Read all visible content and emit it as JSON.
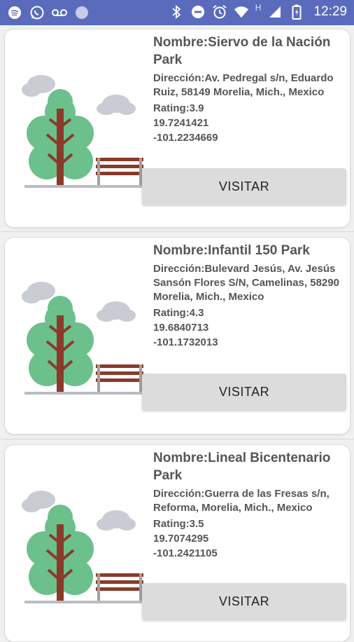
{
  "status_bar": {
    "time": "12:29",
    "network_label": "H",
    "left_icons": [
      "spotify-icon",
      "whatsapp-icon",
      "voicemail-icon",
      "circle-icon"
    ],
    "right_icons": [
      "bluetooth-icon",
      "do-not-disturb-icon",
      "alarm-icon",
      "wifi-icon",
      "signal-icon",
      "battery-icon"
    ]
  },
  "parks": [
    {
      "name": "Nombre:Siervo de la Nación Park",
      "address": "Dirección:Av. Pedregal s/n, Eduardo Ruiz, 58149 Morelia, Mich., Mexico",
      "rating": "Rating:3.9",
      "lat": "19.7241421",
      "lng": "-101.2234669",
      "button": "VISITAR"
    },
    {
      "name": "Nombre:Infantil 150 Park",
      "address": "Dirección:Bulevard Jesús, Av. Jesús Sansón Flores S/N, Camelinas, 58290 Morelia, Mich., Mexico",
      "rating": "Rating:4.3",
      "lat": "19.6840713",
      "lng": "-101.1732013",
      "button": "VISITAR"
    },
    {
      "name": "Nombre:Lineal Bicentenario Park",
      "address": "Dirección:Guerra de las Fresas s/n, Reforma, Morelia, Mich., Mexico",
      "rating": "Rating:3.5",
      "lat": "19.7074295",
      "lng": "-101.2421105",
      "button": "VISITAR"
    }
  ],
  "colors": {
    "status_bar": "#5a6bbd",
    "tree_foliage": "#6cc08b",
    "tree_trunk": "#8a3a2b",
    "cloud": "#c9ccd2",
    "bench": "#8a3a2b",
    "button_bg": "#dcdcdc"
  }
}
